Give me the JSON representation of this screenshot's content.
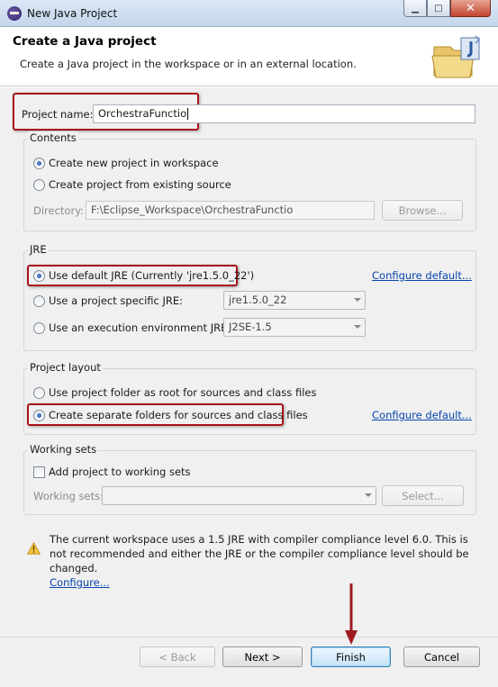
{
  "window": {
    "title": "New Java Project",
    "buttons": {
      "minimize": "▁",
      "maximize": "□",
      "close": "✕"
    }
  },
  "header": {
    "title": "Create a Java project",
    "description": "Create a Java project in the workspace or in an external location."
  },
  "project_name": {
    "label": "Project name:",
    "value": "OrchestraFunctio"
  },
  "contents": {
    "title": "Contents",
    "options": [
      {
        "label": "Create new project in workspace",
        "selected": true
      },
      {
        "label": "Create project from existing source",
        "selected": false
      }
    ],
    "directory_label": "Directory:",
    "directory_value": "F:\\Eclipse_Workspace\\OrchestraFunctio",
    "browse_label": "Browse..."
  },
  "jre": {
    "title": "JRE",
    "options": [
      {
        "label": "Use default JRE (Currently 'jre1.5.0_22')",
        "selected": true
      },
      {
        "label": "Use a project specific JRE:",
        "selected": false,
        "combo": "jre1.5.0_22"
      },
      {
        "label": "Use an execution environment JRE:",
        "selected": false,
        "combo": "J2SE-1.5"
      }
    ],
    "configure_link": "Configure default..."
  },
  "project_layout": {
    "title": "Project layout",
    "options": [
      {
        "label": "Use project folder as root for sources and class files",
        "selected": false
      },
      {
        "label": "Create separate folders for sources and class files",
        "selected": true
      }
    ],
    "configure_link": "Configure default..."
  },
  "working_sets": {
    "title": "Working sets",
    "checkbox_label": "Add project to working sets",
    "checked": false,
    "field_label": "Working sets:",
    "select_label": "Select..."
  },
  "warning": {
    "icon": "warning-icon",
    "text": "The current workspace uses a 1.5 JRE with compiler compliance level 6.0. This is not recommended and either the JRE or the compiler compliance level should be changed.",
    "link": "Configure..."
  },
  "footer": {
    "back": "< Back",
    "next": "Next >",
    "finish": "Finish",
    "cancel": "Cancel"
  },
  "colors": {
    "highlight_box": "#a8141b",
    "annotation_arrow": "#9e1b1f",
    "link": "#0645ad"
  }
}
